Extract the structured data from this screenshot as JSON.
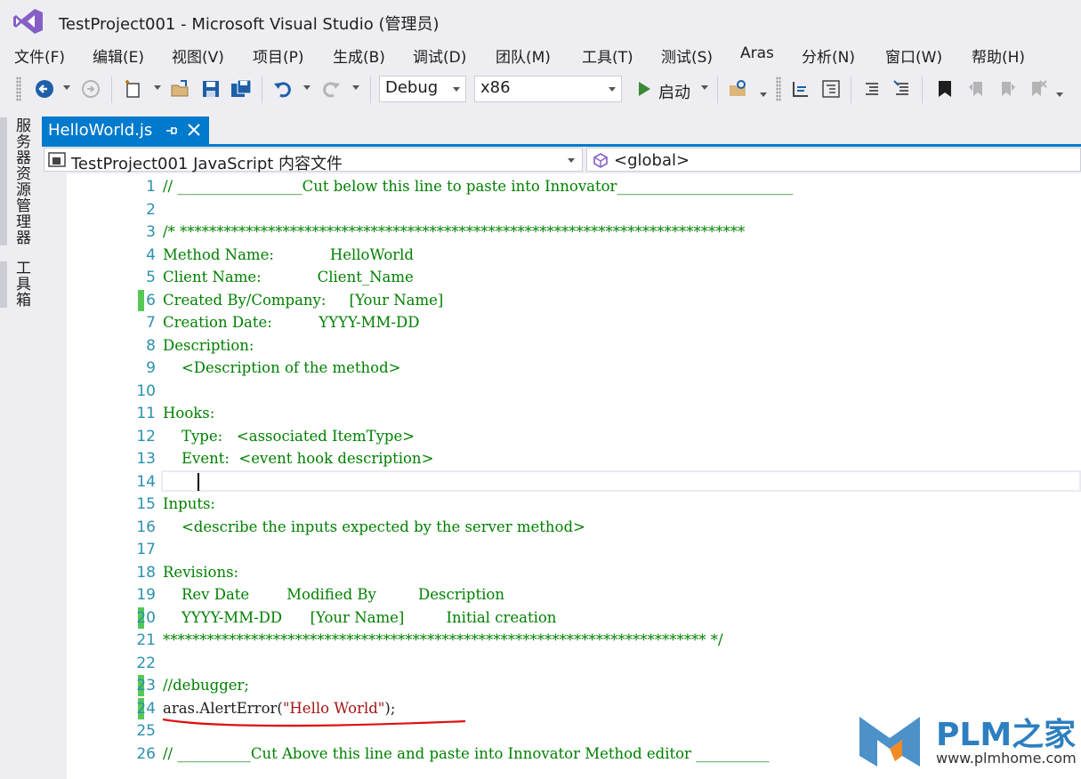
{
  "window": {
    "title": "TestProject001 - Microsoft Visual Studio (管理员)"
  },
  "menu": [
    "文件(F)",
    "编辑(E)",
    "视图(V)",
    "项目(P)",
    "生成(B)",
    "调试(D)",
    "团队(M)",
    "工具(T)",
    "测试(S)",
    "Aras",
    "分析(N)",
    "窗口(W)",
    "帮助(H)"
  ],
  "toolbar": {
    "configuration": "Debug",
    "platform": "x86",
    "start_label": "启动"
  },
  "side_tabs": [
    "服务器资源管理器",
    "工具箱"
  ],
  "document_tab": {
    "label": "HelloWorld.js"
  },
  "navbar": {
    "project_scope": "TestProject001 JavaScript 内容文件",
    "member_scope": "<global>"
  },
  "editor": {
    "current_line": 14,
    "modified_lines": [
      6,
      20,
      23,
      24
    ],
    "lines": [
      {
        "n": "1",
        "text": "// _________________Cut below this line to paste into Innovator________________________"
      },
      {
        "n": "2",
        "text": ""
      },
      {
        "n": "3",
        "text": "/* *****************************************************************************"
      },
      {
        "n": "4",
        "text": "Method Name:            HelloWorld"
      },
      {
        "n": "5",
        "text": "Client Name:            Client_Name"
      },
      {
        "n": "6",
        "text": "Created By/Company:     [Your Name]"
      },
      {
        "n": "7",
        "text": "Creation Date:          YYYY-MM-DD"
      },
      {
        "n": "8",
        "text": "Description:"
      },
      {
        "n": "9",
        "text": "    <Description of the method>"
      },
      {
        "n": "10",
        "text": ""
      },
      {
        "n": "11",
        "text": "Hooks:"
      },
      {
        "n": "12",
        "text": "    Type:   <associated ItemType>"
      },
      {
        "n": "13",
        "text": "    Event:  <event hook description>"
      },
      {
        "n": "14",
        "text": ""
      },
      {
        "n": "15",
        "text": "Inputs:"
      },
      {
        "n": "16",
        "text": "    <describe the inputs expected by the server method>"
      },
      {
        "n": "17",
        "text": ""
      },
      {
        "n": "18",
        "text": "Revisions:"
      },
      {
        "n": "19",
        "text": "    Rev Date        Modified By         Description"
      },
      {
        "n": "20",
        "text": "    YYYY-MM-DD      [Your Name]         Initial creation"
      },
      {
        "n": "21",
        "text": "************************************************************************** */"
      },
      {
        "n": "22",
        "text": ""
      },
      {
        "n": "23",
        "text": "//debugger;"
      },
      {
        "n": "24",
        "code_object": "aras.AlertError(",
        "code_string": "\"Hello World\"",
        "code_end": ");"
      },
      {
        "n": "25",
        "text": ""
      },
      {
        "n": "26",
        "text": "// __________Cut Above this line and paste into Innovator Method editor __________"
      }
    ]
  },
  "watermark": {
    "brand": "PLM之家",
    "url": "www.plmhome.com"
  },
  "colors": {
    "accent": "#007acc",
    "comment": "#008000",
    "string": "#a31515",
    "line_number": "#2b91af",
    "change_marker": "#57c758"
  }
}
